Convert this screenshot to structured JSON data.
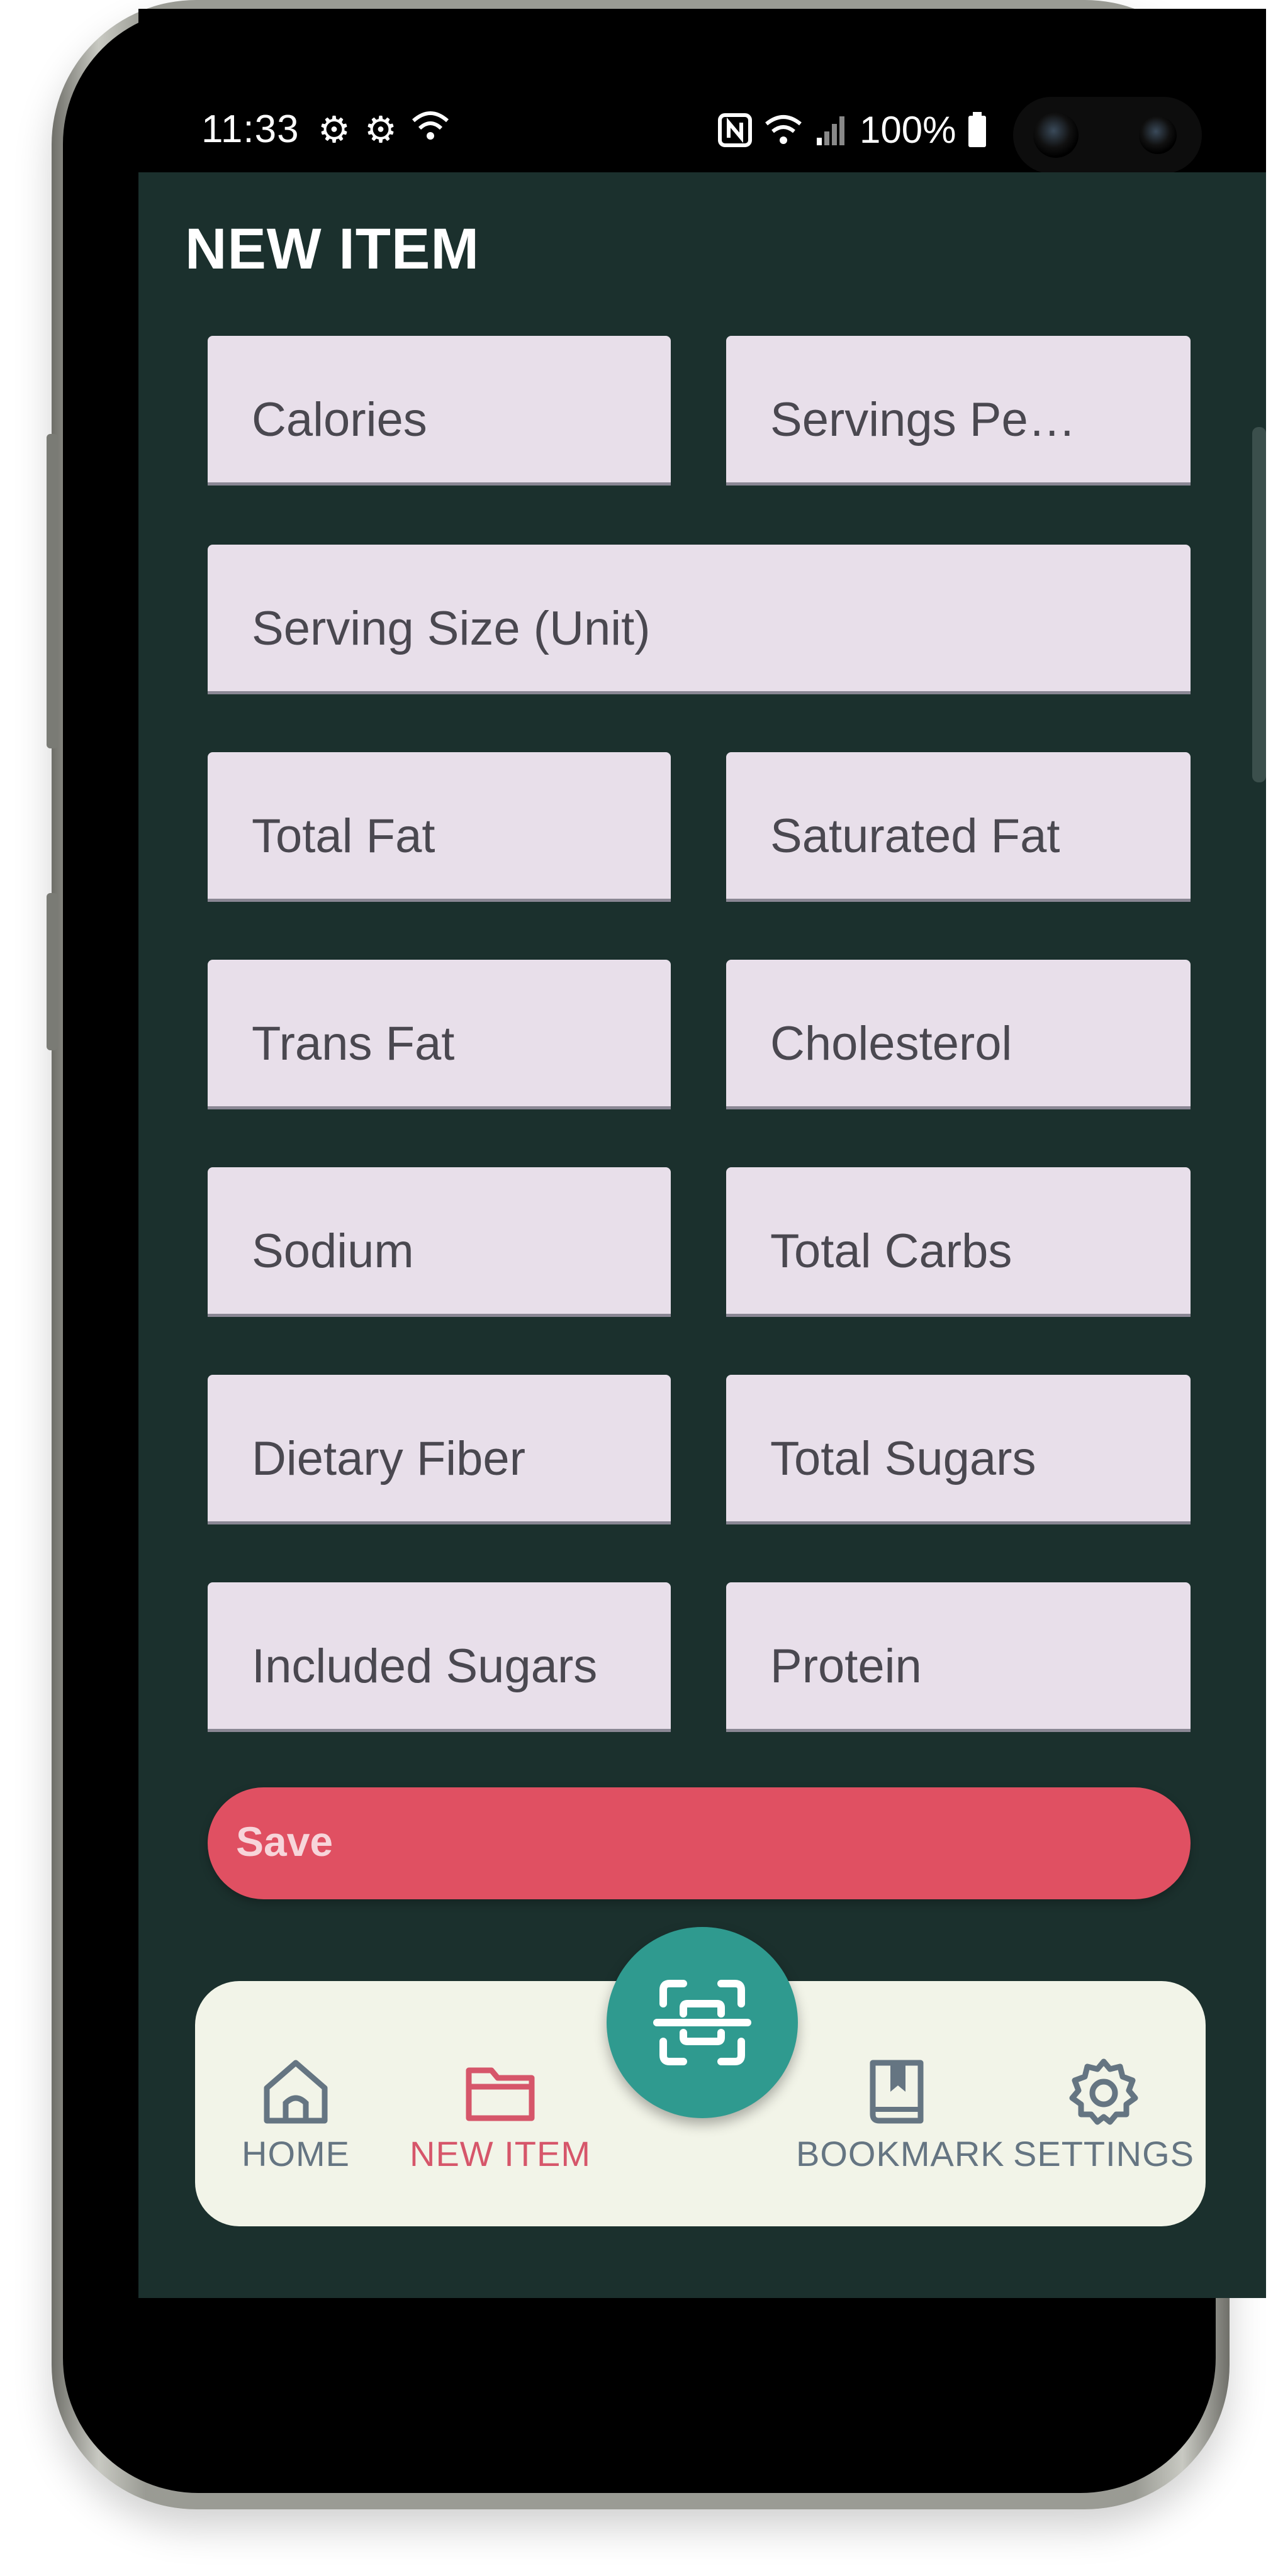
{
  "status_bar": {
    "time": "11:33",
    "battery": "100%",
    "icons_left": [
      "gear-icon",
      "gear-icon",
      "wifi-calling-icon"
    ],
    "icons_right": [
      "nfc-icon",
      "wifi-icon",
      "signal-icon",
      "battery-icon"
    ]
  },
  "page": {
    "title": "NEW ITEM"
  },
  "form": {
    "fields": [
      {
        "label": "Calories"
      },
      {
        "label": "Servings Pe…"
      },
      {
        "label": "Serving Size (Unit)"
      },
      {
        "label": "Total Fat"
      },
      {
        "label": "Saturated Fat"
      },
      {
        "label": "Trans Fat"
      },
      {
        "label": "Cholesterol"
      },
      {
        "label": "Sodium"
      },
      {
        "label": "Total Carbs"
      },
      {
        "label": "Dietary Fiber"
      },
      {
        "label": "Total Sugars"
      },
      {
        "label": "Included Sugars"
      },
      {
        "label": "Protein"
      }
    ],
    "save_label": "Save"
  },
  "bottom_nav": {
    "items": [
      {
        "label": "HOME",
        "icon": "home-icon",
        "active": false
      },
      {
        "label": "NEW ITEM",
        "icon": "folder-icon",
        "active": true
      },
      {
        "label": "BOOKMARK",
        "icon": "bookmark-book-icon",
        "active": false
      },
      {
        "label": "SETTINGS",
        "icon": "gear-icon",
        "active": false
      }
    ],
    "fab_icon": "scan-icon"
  },
  "colors": {
    "app_background": "#1b302d",
    "field_background": "#e8dfea",
    "save_button": "#e05062",
    "fab": "#2f9a8f",
    "nav_background": "#f2f4e8",
    "nav_active": "#d6566a",
    "nav_inactive": "#657582"
  }
}
